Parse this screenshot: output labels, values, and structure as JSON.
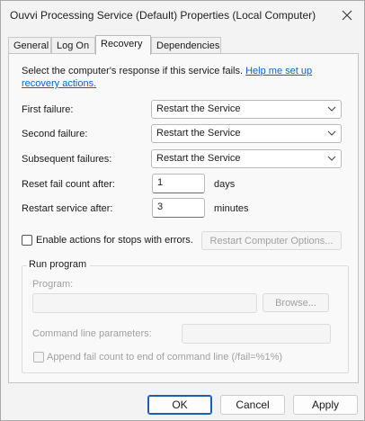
{
  "window": {
    "title": "Ouvvi Processing Service (Default) Properties (Local Computer)"
  },
  "tabs": [
    {
      "label": "General",
      "active": false
    },
    {
      "label": "Log On",
      "active": false
    },
    {
      "label": "Recovery",
      "active": true
    },
    {
      "label": "Dependencies",
      "active": false
    }
  ],
  "recovery": {
    "description": "Select the computer's response if this service fails.",
    "help_link": "Help me set up recovery actions.",
    "first_failure": {
      "label": "First failure:",
      "value": "Restart the Service"
    },
    "second_failure": {
      "label": "Second failure:",
      "value": "Restart the Service"
    },
    "subsequent_failures": {
      "label": "Subsequent failures:",
      "value": "Restart the Service"
    },
    "reset_fail_count": {
      "label": "Reset fail count after:",
      "value": "1",
      "unit": "days"
    },
    "restart_service": {
      "label": "Restart service after:",
      "value": "3",
      "unit": "minutes"
    },
    "enable_actions": {
      "label": "Enable actions for stops with errors.",
      "checked": false
    },
    "restart_computer_options": "Restart Computer Options...",
    "run_program": {
      "group_label": "Run program",
      "program_label": "Program:",
      "program_value": "",
      "browse_label": "Browse...",
      "params_label": "Command line parameters:",
      "params_value": "",
      "append_label": "Append fail count to end of command line (/fail=%1%)",
      "append_checked": false
    }
  },
  "footer": {
    "ok": "OK",
    "cancel": "Cancel",
    "apply": "Apply"
  },
  "icons": {
    "close": "close-icon",
    "dropdown": "chevron-down-icon"
  }
}
